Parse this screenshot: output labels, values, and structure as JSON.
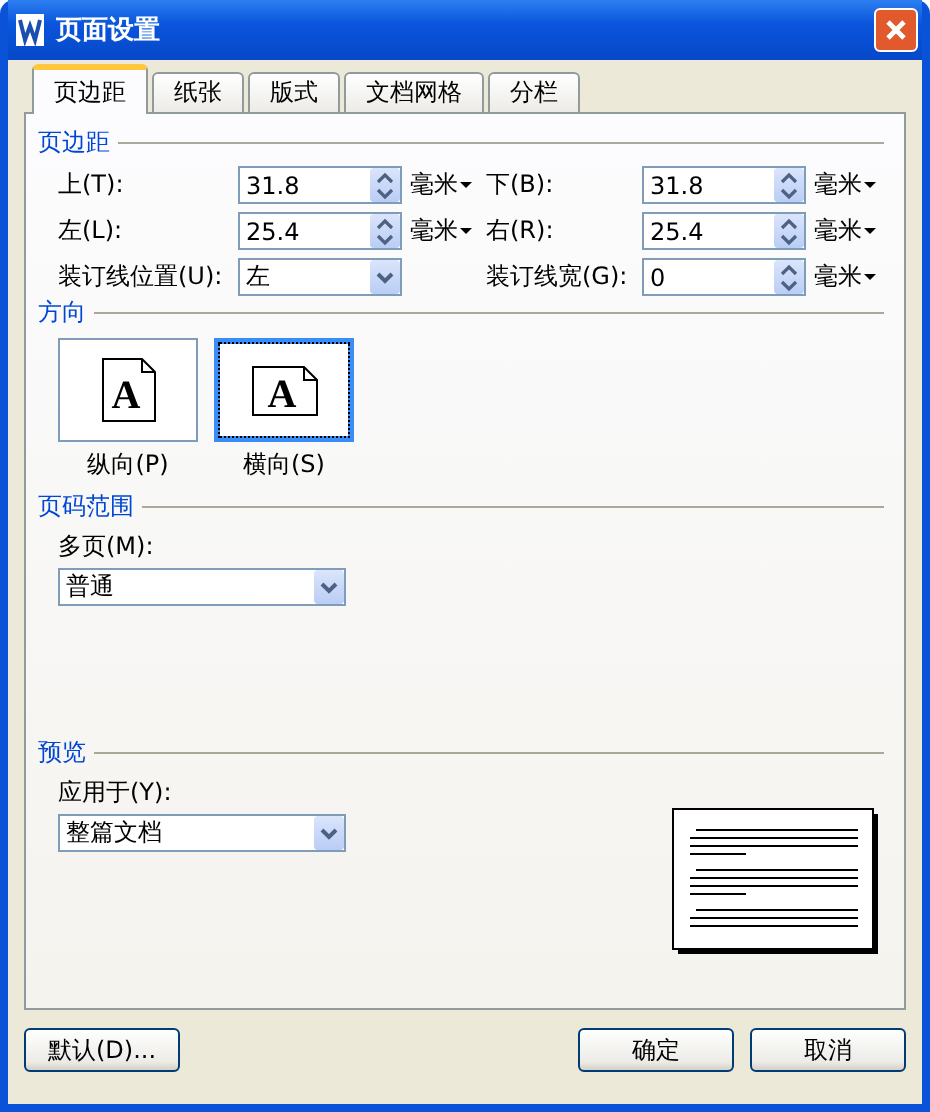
{
  "window": {
    "title": "页面设置"
  },
  "tabs": [
    {
      "label": "页边距",
      "selected": true
    },
    {
      "label": "纸张",
      "selected": false
    },
    {
      "label": "版式",
      "selected": false
    },
    {
      "label": "文档网格",
      "selected": false
    },
    {
      "label": "分栏",
      "selected": false
    }
  ],
  "margins": {
    "heading": "页边距",
    "fields": [
      {
        "label": "上(T):",
        "value": "31.8",
        "unit": "毫米",
        "kind": "spin"
      },
      {
        "label": "下(B):",
        "value": "31.8",
        "unit": "毫米",
        "kind": "spin"
      },
      {
        "label": "左(L):",
        "value": "25.4",
        "unit": "毫米",
        "kind": "spin"
      },
      {
        "label": "右(R):",
        "value": "25.4",
        "unit": "毫米",
        "kind": "spin"
      },
      {
        "label": "装订线位置(U):",
        "value": "左",
        "kind": "select"
      },
      {
        "label": "装订线宽(G):",
        "value": "0",
        "unit": "毫米",
        "kind": "spin"
      }
    ]
  },
  "orientation": {
    "heading": "方向",
    "options": [
      {
        "label": "纵向(P)",
        "kind": "portrait",
        "icon_text": "A",
        "selected": false
      },
      {
        "label": "横向(S)",
        "kind": "landscape",
        "icon_text": "A",
        "selected": true
      }
    ]
  },
  "page_range": {
    "heading": "页码范围",
    "label": "多页(M):",
    "value": "普通"
  },
  "preview": {
    "heading": "预览",
    "label": "应用于(Y):",
    "value": "整篇文档"
  },
  "buttons": [
    "默认(D)...",
    "确定",
    "取消"
  ]
}
